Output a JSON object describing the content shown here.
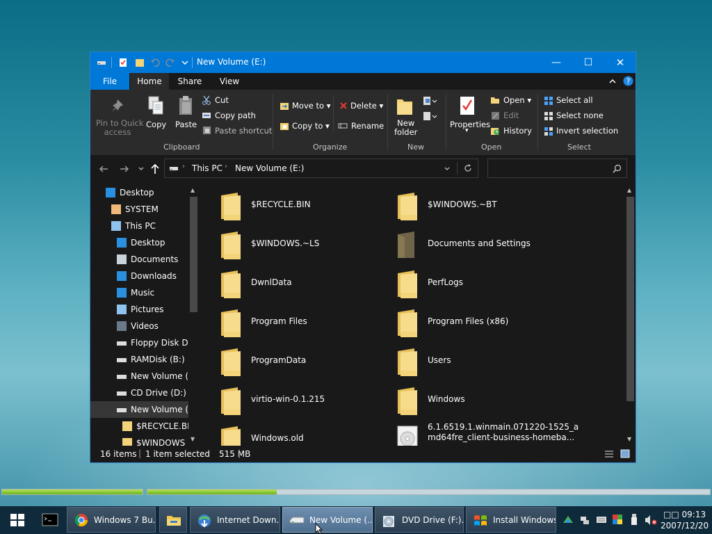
{
  "window": {
    "title": "New Volume (E:)",
    "controls": {
      "minimize": "—",
      "maximize": "☐",
      "close": "✕"
    }
  },
  "tabs": [
    "File",
    "Home",
    "Share",
    "View"
  ],
  "ribbon": {
    "clipboard": {
      "pin": [
        "Pin to Quick",
        "access"
      ],
      "copy": "Copy",
      "paste": "Paste",
      "cut": "Cut",
      "copy_path": "Copy path",
      "paste_shortcut": "Paste shortcut",
      "group": "Clipboard"
    },
    "organize": {
      "move_to": "Move to",
      "copy_to": "Copy to",
      "delete": "Delete",
      "rename": "Rename",
      "group": "Organize"
    },
    "new": {
      "new_folder": [
        "New",
        "folder"
      ],
      "group": "New"
    },
    "open": {
      "properties": "Properties",
      "open": "Open",
      "edit": "Edit",
      "history": "History",
      "group": "Open"
    },
    "select": {
      "select_all": "Select all",
      "select_none": "Select none",
      "invert": "Invert selection",
      "group": "Select"
    }
  },
  "address": {
    "segments": [
      "This PC",
      "New Volume (E:)"
    ],
    "search_placeholder": ""
  },
  "nav": [
    {
      "label": "Desktop",
      "icon": "desktop-icon"
    },
    {
      "label": "SYSTEM",
      "icon": "user-icon"
    },
    {
      "label": "This PC",
      "icon": "computer-icon"
    },
    {
      "label": "Desktop",
      "icon": "desktop-icon"
    },
    {
      "label": "Documents",
      "icon": "documents-icon"
    },
    {
      "label": "Downloads",
      "icon": "downloads-icon"
    },
    {
      "label": "Music",
      "icon": "music-icon"
    },
    {
      "label": "Pictures",
      "icon": "pictures-icon"
    },
    {
      "label": "Videos",
      "icon": "videos-icon"
    },
    {
      "label": "Floppy Disk Dri",
      "icon": "floppy-icon"
    },
    {
      "label": "RAMDisk (B:)",
      "icon": "drive-icon"
    },
    {
      "label": "New Volume (C",
      "icon": "drive-icon"
    },
    {
      "label": "CD Drive (D:)",
      "icon": "cd-icon"
    },
    {
      "label": "New Volume (E",
      "icon": "drive-icon"
    },
    {
      "label": "$RECYCLE.BIN",
      "icon": "folder-icon"
    },
    {
      "label": "$WINDOWS",
      "icon": "folder-icon"
    }
  ],
  "files": [
    {
      "name": "$RECYCLE.BIN",
      "icon": "folder-icon"
    },
    {
      "name": "$WINDOWS.~BT",
      "icon": "folder-icon"
    },
    {
      "name": "$WINDOWS.~LS",
      "icon": "folder-icon"
    },
    {
      "name": "Documents and Settings",
      "icon": "folder-shortcut-icon"
    },
    {
      "name": "DwnlData",
      "icon": "folder-icon"
    },
    {
      "name": "PerfLogs",
      "icon": "folder-icon"
    },
    {
      "name": "Program Files",
      "icon": "folder-icon"
    },
    {
      "name": "Program Files (x86)",
      "icon": "folder-icon"
    },
    {
      "name": "ProgramData",
      "icon": "folder-icon"
    },
    {
      "name": "Users",
      "icon": "folder-icon"
    },
    {
      "name": "virtio-win-0.1.215",
      "icon": "folder-icon"
    },
    {
      "name": "Windows",
      "icon": "folder-icon"
    },
    {
      "name": "Windows.old",
      "icon": "folder-icon"
    },
    {
      "name": "6.1.6519.1.winmain.071220-1525_amd64fre_client-business-homeba...",
      "line1": "6.1.6519.1.winmain.071220-1525_a",
      "line2": "md64fre_client-business-homeba...",
      "icon": "disc-image-icon"
    }
  ],
  "status": {
    "count": "16 items",
    "selected": "1 item selected",
    "size": "515 MB"
  },
  "taskbar": {
    "buttons": [
      {
        "label": "",
        "icon": "cmd-icon"
      },
      {
        "label": "Windows 7 Bu...",
        "icon": "chrome-icon"
      },
      {
        "label": "",
        "icon": "explorer-icon"
      },
      {
        "label": "Internet Down...",
        "icon": "idm-icon"
      },
      {
        "label": "New Volume (...",
        "icon": "drive-icon"
      },
      {
        "label": "DVD Drive (F:)...",
        "icon": "dvd-icon"
      },
      {
        "label": "Install Windows",
        "icon": "windows-flag-icon"
      }
    ],
    "clock_time": "□□ 09:13",
    "clock_date": "2007/12/20"
  },
  "progress": {
    "bar1": 1.0,
    "bar2": 0.23
  },
  "colors": {
    "accent": "#0078d7",
    "folder": "#f3d47a",
    "dark_bg": "#191919",
    "ribbon_bg": "#2b2b2b"
  }
}
